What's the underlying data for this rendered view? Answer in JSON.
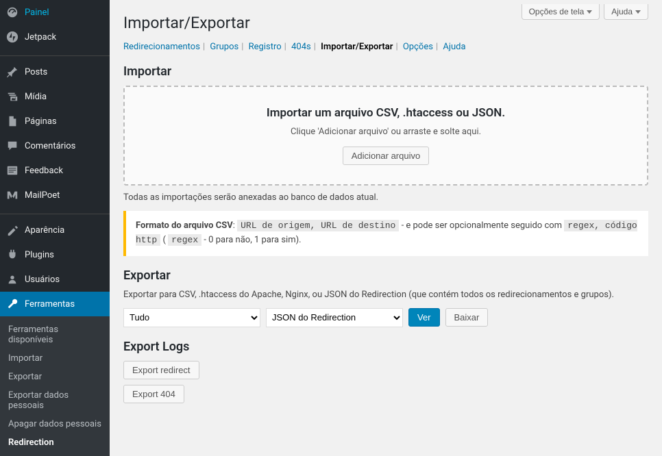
{
  "topButtons": {
    "screenOptions": "Opções de tela",
    "help": "Ajuda"
  },
  "sidebar": {
    "items": [
      {
        "label": "Painel",
        "icon": "dashboard"
      },
      {
        "label": "Jetpack",
        "icon": "jetpack"
      },
      {
        "label": "Posts",
        "icon": "pin"
      },
      {
        "label": "Mídia",
        "icon": "media"
      },
      {
        "label": "Páginas",
        "icon": "pages"
      },
      {
        "label": "Comentários",
        "icon": "comments"
      },
      {
        "label": "Feedback",
        "icon": "feedback"
      },
      {
        "label": "MailPoet",
        "icon": "mailpoet"
      },
      {
        "label": "Aparência",
        "icon": "appearance"
      },
      {
        "label": "Plugins",
        "icon": "plugins"
      },
      {
        "label": "Usuários",
        "icon": "users"
      },
      {
        "label": "Ferramentas",
        "icon": "tools"
      }
    ],
    "submenu": [
      "Ferramentas disponíveis",
      "Importar",
      "Exportar",
      "Exportar dados pessoais",
      "Apagar dados pessoais",
      "Redirection"
    ]
  },
  "page": {
    "title": "Importar/Exportar",
    "subnav": [
      "Redirecionamentos",
      "Grupos",
      "Registro",
      "404s",
      "Importar/Exportar",
      "Opções",
      "Ajuda"
    ],
    "subnavCurrent": "Importar/Exportar"
  },
  "import": {
    "heading": "Importar",
    "dropTitle": "Importar um arquivo CSV, .htaccess ou JSON.",
    "dropInstruction": "Clique 'Adicionar arquivo' ou arraste e solte aqui.",
    "addFileBtn": "Adicionar arquivo",
    "note": "Todas as importações serão anexadas ao banco de dados atual.",
    "callout": {
      "formatLabel": "Formato do arquivo CSV",
      "code1": "URL de origem, URL de destino",
      "midText": " - e pode ser opcionalmente seguido com ",
      "code2": "regex, código http",
      "paren1": " ( ",
      "code3": "regex",
      "tail": " - 0 para não, 1 para sim)."
    }
  },
  "export": {
    "heading": "Exportar",
    "desc": "Exportar para CSV, .htaccess do Apache, Nginx, ou JSON do Redirection (que contém todos os redirecionamentos e grupos).",
    "select1": "Tudo",
    "select2": "JSON do Redirection",
    "viewBtn": "Ver",
    "downloadBtn": "Baixar"
  },
  "exportLogs": {
    "heading": "Export Logs",
    "redirectBtn": "Export redirect",
    "fourohfourBtn": "Export 404"
  }
}
